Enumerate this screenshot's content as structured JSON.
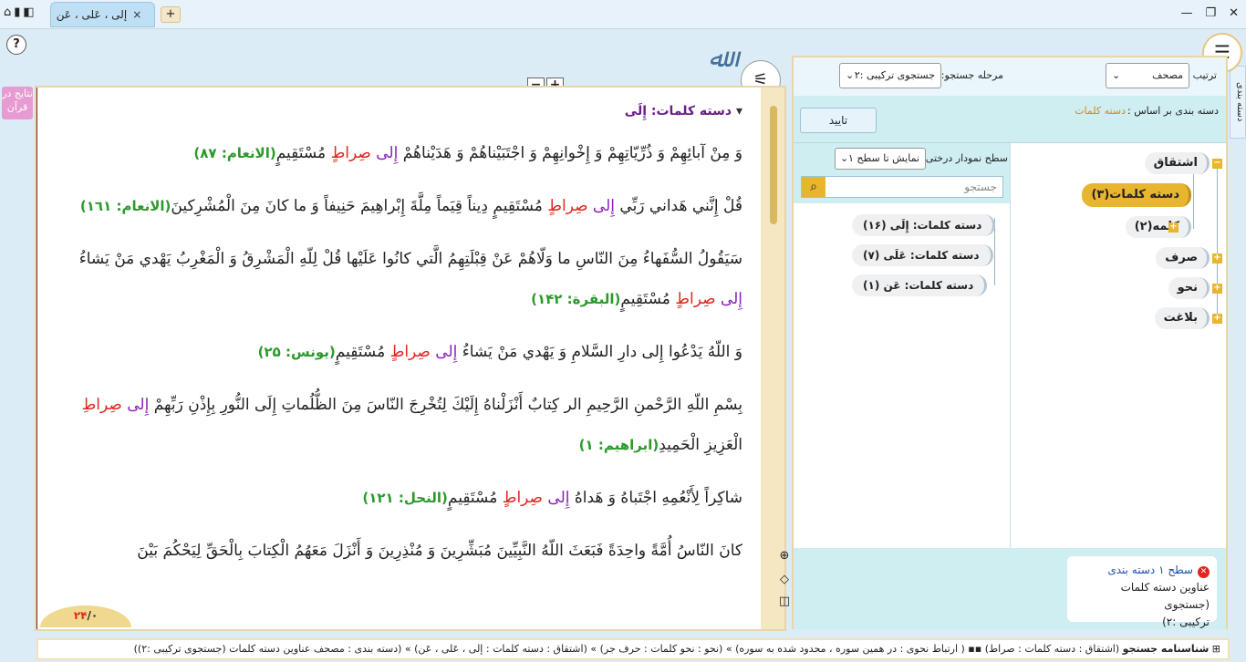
{
  "tab": {
    "title": "إلی ، عَلی ، عَن",
    "close": "×",
    "add": "+"
  },
  "help": "?",
  "side_label": "نتایج در قرآن",
  "right_vertical_tab": "دسته بندی",
  "logo_text": "بسم الله الرحمن الرحیم",
  "zoom": {
    "minus": "−",
    "plus": "+"
  },
  "text_panel": {
    "group_title": "دسته کلمات: إِلَی",
    "verses": [
      {
        "parts": [
          {
            "t": "وَ مِنْ آبائِهِمْ وَ ذُرِّيّاتِهِمْ وَ إِخْوانِهِمْ وَ اجْتَبَيْناهُمْ وَ هَدَيْناهُمْ ",
            "c": ""
          },
          {
            "t": "إِلى",
            "c": "purple"
          },
          {
            "t": " ",
            "c": ""
          },
          {
            "t": "صِراطٍ",
            "c": "red"
          },
          {
            "t": " مُسْتَقِيمٍ",
            "c": ""
          },
          {
            "t": "(الانعام: ٨٧)",
            "c": "ref"
          }
        ]
      },
      {
        "parts": [
          {
            "t": "قُلْ إِنَّني‏ هَداني‏ رَبِّي ",
            "c": ""
          },
          {
            "t": "إِلى",
            "c": "purple"
          },
          {
            "t": " ",
            "c": ""
          },
          {
            "t": "صِراطٍ",
            "c": "red"
          },
          {
            "t": " مُسْتَقِيمٍ دِيناً قِيَماً مِلَّةَ إِبْراهِيمَ حَنِيفاً وَ ما كانَ مِنَ الْمُشْرِكينَ",
            "c": ""
          },
          {
            "t": "(الانعام: ١٦١)",
            "c": "ref"
          }
        ]
      },
      {
        "parts": [
          {
            "t": "سَيَقُولُ السُّفَهاءُ مِنَ النّاسِ ما وَلّاهُمْ عَنْ قِبْلَتِهِمُ الَّتي كانُوا عَلَيْها قُلْ لِلّهِ الْمَشْرِقُ وَ الْمَغْرِبُ يَهْدي مَنْ يَشاءُ ",
            "c": ""
          },
          {
            "t": "إِلى",
            "c": "purple"
          },
          {
            "t": " ",
            "c": ""
          },
          {
            "t": "صِراطٍ",
            "c": "red"
          },
          {
            "t": " مُسْتَقِيمٍ",
            "c": ""
          },
          {
            "t": "(البقرة: ١۴٢)",
            "c": "ref"
          }
        ]
      },
      {
        "parts": [
          {
            "t": "وَ اللّهُ يَدْعُوا إِلى دارِ السَّلامِ وَ يَهْدي مَنْ يَشاءُ ",
            "c": ""
          },
          {
            "t": "إِلى",
            "c": "purple"
          },
          {
            "t": " ",
            "c": ""
          },
          {
            "t": "صِراطٍ",
            "c": "red"
          },
          {
            "t": " مُسْتَقِيمٍ",
            "c": ""
          },
          {
            "t": "(يونس: ٢۵)",
            "c": "ref"
          }
        ]
      },
      {
        "parts": [
          {
            "t": "بِسْمِ اللّهِ الرَّحْمنِ الرَّحِيمِ الر كِتابٌ أَنْزَلْناهُ إِلَيْكَ لِتُخْرِجَ النّاسَ مِنَ الظُّلُماتِ إِلَى النُّورِ بِإِذْنِ رَبِّهِمْ ",
            "c": ""
          },
          {
            "t": "إِلى",
            "c": "purple"
          },
          {
            "t": " ",
            "c": ""
          },
          {
            "t": "صِراطِ",
            "c": "red"
          },
          {
            "t": " الْعَزِيزِ الْحَمِيدِ",
            "c": ""
          },
          {
            "t": "(ابراهيم: ١)",
            "c": "ref"
          }
        ]
      },
      {
        "parts": [
          {
            "t": "شاكِراً لِأَنْعُمِهِ اجْتَباهُ وَ هَداهُ ",
            "c": ""
          },
          {
            "t": "إِلى",
            "c": "purple"
          },
          {
            "t": " ",
            "c": ""
          },
          {
            "t": "صِراطٍ",
            "c": "red"
          },
          {
            "t": " مُسْتَقِيمٍ",
            "c": ""
          },
          {
            "t": "(النحل: ١٢١)",
            "c": "ref"
          }
        ]
      },
      {
        "parts": [
          {
            "t": "كانَ النّاسُ أُمَّةً واحِدَةً فَبَعَثَ اللّهُ النَّبِيِّينَ مُبَشِّرِينَ وَ مُنْذِرِينَ وَ أَنْزَلَ مَعَهُمُ الْكِتابَ بِالْحَقِّ لِيَحْكُمَ بَيْنَ",
            "c": ""
          }
        ]
      }
    ],
    "page_counter": {
      "total": "٢۴",
      "sep": "/",
      "current": "٠"
    }
  },
  "right_panel": {
    "sort_label": "ترتیب",
    "sort_value": "مصحف",
    "stage_label": "مرحله جستجو:",
    "stage_value": "جستجوی ترکیبی :٢",
    "classify_label": "دسته بندی بر اساس :",
    "classify_value": "دسته کلمات",
    "confirm": "تایید",
    "tree_level_label": "سطح نمودار درختی:",
    "tree_level_value": "نمایش تا سطح ١",
    "search_placeholder": "جستجو",
    "tree": [
      {
        "label": "اشتقاق"
      },
      {
        "label": "دسته کلمات(٣)"
      },
      {
        "label": "کلمه(٢)"
      },
      {
        "label": "صرف"
      },
      {
        "label": "نحو"
      },
      {
        "label": "بلاغت"
      }
    ],
    "results": [
      {
        "label": "دسته کلمات: إِلَی (١۶)"
      },
      {
        "label": "دسته کلمات: عَلَی (٧)"
      },
      {
        "label": "دسته کلمات: عَن (١)"
      }
    ],
    "level_card": {
      "title": "سطح ١ دسته بندی",
      "line1": "عناوین دسته کلمات (جستجوی",
      "line2": "ترکیبی :٢)"
    }
  },
  "status": {
    "label": "شناسنامه جستجو",
    "text": "(اشتقاق : دسته کلمات : صراط) ▪▪ ( ارتباط نحوی : در همین سوره ، محدود شده به سوره) » (نحو : نحو کلمات : حرف جر) » (اشتقاق : دسته کلمات : إلی ، عَلی ، عَن) » (دسته بندی : مصحف عناوین دسته کلمات (جستجوی ترکیبی :٢))"
  }
}
